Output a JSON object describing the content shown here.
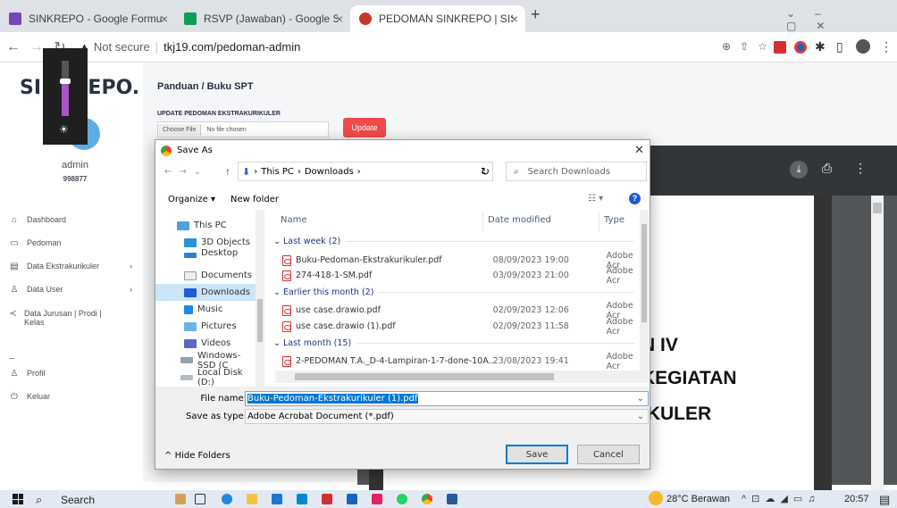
{
  "browser": {
    "tabs": [
      {
        "label": "SINKREPO - Google Formulir",
        "color": "#7248b9"
      },
      {
        "label": "RSVP (Jawaban) - Google Spread",
        "color": "#0f9d58"
      },
      {
        "label": "PEDOMAN SINKREPO | SISTEM I",
        "color": "#c0392b"
      }
    ],
    "new_tab": "+",
    "address_prefix": "Not secure",
    "address_url": "tkj19.com/pedoman-admin"
  },
  "sidebar": {
    "logo": "SINKREPO.",
    "user_name": "admin",
    "user_id": "998877",
    "items": [
      {
        "label": "Dashboard",
        "icon": "home-icon"
      },
      {
        "label": "Pedoman",
        "icon": "doc-icon"
      },
      {
        "label": "Data Ekstrakurikuler",
        "icon": "list-icon"
      },
      {
        "label": "Data User",
        "icon": "user-icon"
      },
      {
        "label": "Data Jurusan | Prodi | Kelas",
        "icon": "share-icon"
      },
      {
        "label": "Profil",
        "icon": "user-icon"
      },
      {
        "label": "Keluar",
        "icon": "power-icon"
      }
    ]
  },
  "main": {
    "title": "Panduan / Buku SPT",
    "form_label": "UPDATE PEDOMAN EKSTRAKURIKULER",
    "choose_file": "Choose File",
    "no_file": "No file chosen",
    "update_button": "Update"
  },
  "pdf": {
    "lines": [
      "N IV",
      "KEGIATAN",
      "IKULER"
    ]
  },
  "dialog": {
    "title": "Save As",
    "breadcrumb": [
      "This PC",
      "Downloads"
    ],
    "search_placeholder": "Search Downloads",
    "organize": "Organize ▾",
    "new_folder": "New folder",
    "tree": [
      "This PC",
      "3D Objects",
      "Desktop",
      "Documents",
      "Downloads",
      "Music",
      "Pictures",
      "Videos",
      "Windows-SSD (C",
      "Local Disk (D:)"
    ],
    "columns": [
      "Name",
      "Date modified",
      "Type"
    ],
    "groups": [
      {
        "label": "Last week (2)",
        "files": [
          {
            "name": "Buku-Pedoman-Ekstrakurikuler.pdf",
            "date": "08/09/2023 19:00",
            "type": "Adobe Acr"
          },
          {
            "name": "274-418-1-SM.pdf",
            "date": "03/09/2023 21:00",
            "type": "Adobe Acr"
          }
        ]
      },
      {
        "label": "Earlier this month (2)",
        "files": [
          {
            "name": "use case.drawio.pdf",
            "date": "02/09/2023 12:06",
            "type": "Adobe Acr"
          },
          {
            "name": "use case.drawio (1).pdf",
            "date": "02/09/2023 11:58",
            "type": "Adobe Acr"
          }
        ]
      },
      {
        "label": "Last month (15)",
        "files": [
          {
            "name": "2-PEDOMAN T.A._D-4-Lampiran-1-7-done-10A...",
            "date": "23/08/2023 19:41",
            "type": "Adobe Acr"
          }
        ]
      }
    ],
    "file_name_label": "File name:",
    "file_name_value": "Buku-Pedoman-Ekstrakurikuler (1).pdf",
    "save_type_label": "Save as type:",
    "save_type_value": "Adobe Acrobat Document (*.pdf)",
    "hide_folders": "Hide Folders",
    "save": "Save",
    "cancel": "Cancel"
  },
  "taskbar": {
    "search": "Search",
    "weather": "28°C  Berawan",
    "time": "20:57"
  }
}
